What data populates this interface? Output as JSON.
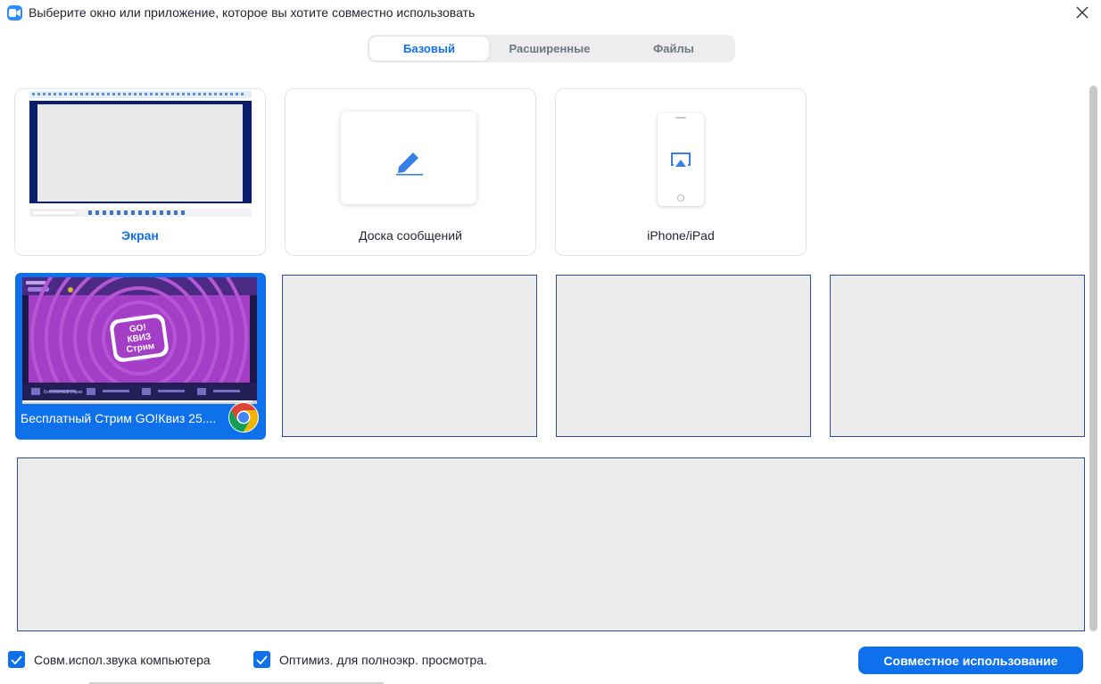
{
  "window": {
    "title": "Выберите окно или приложение, которое вы хотите совместно использовать",
    "app_icon": "video-camera-icon",
    "close_icon": "close-icon"
  },
  "tabs": [
    {
      "label": "Базовый",
      "active": true
    },
    {
      "label": "Расширенные",
      "active": false
    },
    {
      "label": "Файлы",
      "active": false
    }
  ],
  "sources": [
    {
      "label": "Экран",
      "icon": "desktop-screen-thumbnail"
    },
    {
      "label": "Доска сообщений",
      "icon": "pencil-icon"
    },
    {
      "label": "iPhone/iPad",
      "icon": "airplay-icon"
    }
  ],
  "windows": [
    {
      "label": "Бесплатный Стрим GO!Квиз 25....",
      "selected": true,
      "app_icon": "chrome-icon",
      "thumb_logo": "GO! КВИЗ Стрим",
      "thumb_caption": "Бесплатный стрим"
    }
  ],
  "footer": {
    "share_sound": {
      "label": "Совм.испол.звука компьютера",
      "checked": true
    },
    "optimize": {
      "label": "Оптимиз. для полноэкр. просмотра.",
      "checked": true
    },
    "share_button": "Совместное использование"
  },
  "colors": {
    "accent": "#0E71EB",
    "tile_background": "#EBEBEB",
    "tile_border": "#2E4C8F",
    "thumb_purple": "#A53EC7"
  }
}
